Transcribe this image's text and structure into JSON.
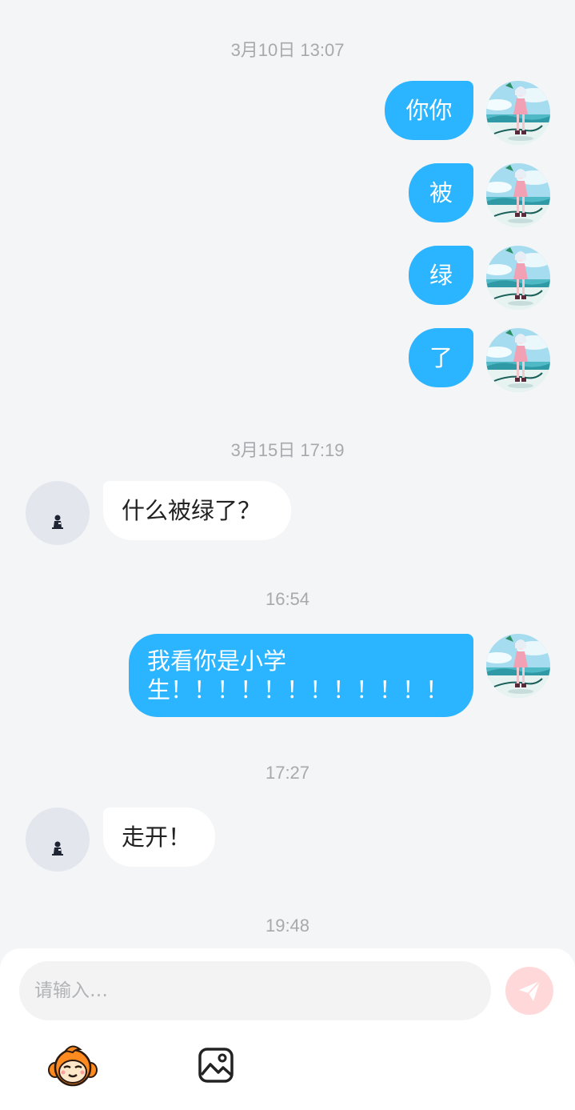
{
  "chat": {
    "timestamps": [
      "3月10日 13:07",
      "3月15日 17:19",
      "16:54",
      "17:27",
      "19:48"
    ],
    "messages": [
      {
        "from": "me",
        "text": "你你"
      },
      {
        "from": "me",
        "text": "被"
      },
      {
        "from": "me",
        "text": "绿"
      },
      {
        "from": "me",
        "text": "了"
      },
      {
        "from": "them",
        "text": "什么被绿了？"
      },
      {
        "from": "me",
        "line1": "我看你是小学",
        "line2": "生！！！！！！！！！！！！"
      },
      {
        "from": "them",
        "text": "走开！"
      }
    ]
  },
  "composer": {
    "placeholder": "请输入…",
    "send_icon": "send-icon",
    "emoji_icon": "monkey-emoji-icon",
    "image_icon": "image-icon"
  },
  "colors": {
    "my_bubble": "#2bb4ff",
    "their_bubble": "#ffffff",
    "background": "#f4f5f7",
    "send_button": "#ffd9d9"
  }
}
